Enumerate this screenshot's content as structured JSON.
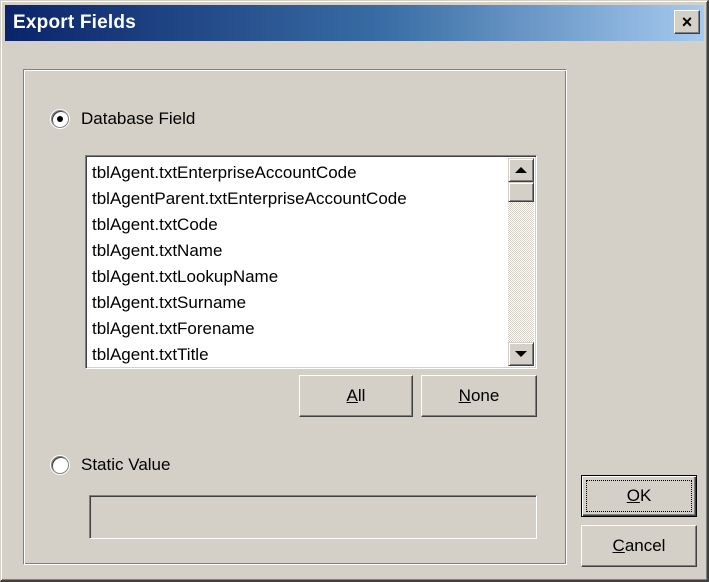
{
  "window": {
    "title": "Export Fields",
    "close_symbol": "×"
  },
  "database_field": {
    "label": "Database Field",
    "selected": true,
    "list_items": [
      "tblAgent.txtEnterpriseAccountCode",
      "tblAgentParent.txtEnterpriseAccountCode",
      "tblAgent.txtCode",
      "tblAgent.txtName",
      "tblAgent.txtLookupName",
      "tblAgent.txtSurname",
      "tblAgent.txtForename",
      "tblAgent.txtTitle"
    ],
    "all_button": {
      "mnemonic": "A",
      "rest": "ll"
    },
    "none_button": {
      "mnemonic": "N",
      "rest": "one"
    }
  },
  "static_value": {
    "label": "Static Value",
    "selected": false,
    "value": ""
  },
  "ok_button": {
    "mnemonic": "O",
    "rest": "K"
  },
  "cancel_button": {
    "mnemonic": "C",
    "rest": "ancel"
  },
  "icons": [
    "close-icon",
    "scroll-up-arrow-icon",
    "scroll-down-arrow-icon"
  ]
}
